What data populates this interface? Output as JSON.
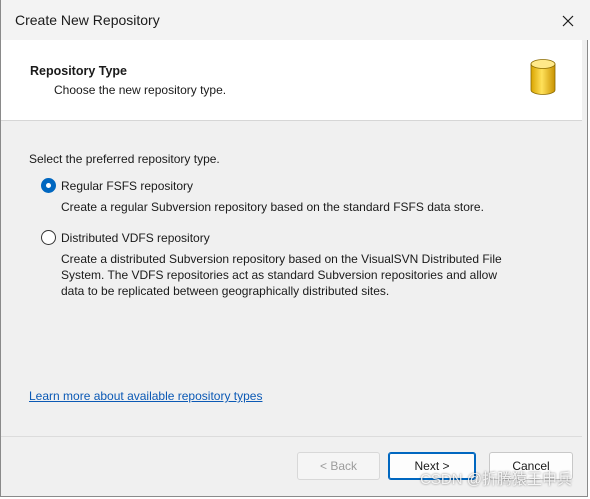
{
  "window": {
    "title": "Create New Repository"
  },
  "header": {
    "title": "Repository Type",
    "subtitle": "Choose the new repository type."
  },
  "content": {
    "prompt": "Select the preferred repository type.",
    "options": [
      {
        "label": "Regular FSFS repository",
        "checked": true,
        "description": "Create a regular Subversion repository based on the standard FSFS data store."
      },
      {
        "label": "Distributed VDFS repository",
        "checked": false,
        "description_lines": [
          "Create a distributed Subversion repository based on the VisualSVN Distributed File",
          "System. The VDFS repositories act as standard Subversion repositories and allow",
          "data to be replicated between geographically distributed sites."
        ]
      }
    ],
    "learn_more_link": "Learn more about available repository types"
  },
  "buttons": {
    "back": "< Back",
    "next": "Next >",
    "cancel": "Cancel"
  },
  "watermark": "CSDN @折腾猿王申兵",
  "colors": {
    "accent": "#0067c0",
    "link": "#0b59b5",
    "db_icon": "#f2c300"
  },
  "icons": {
    "close": "close-icon",
    "database": "database-icon"
  }
}
